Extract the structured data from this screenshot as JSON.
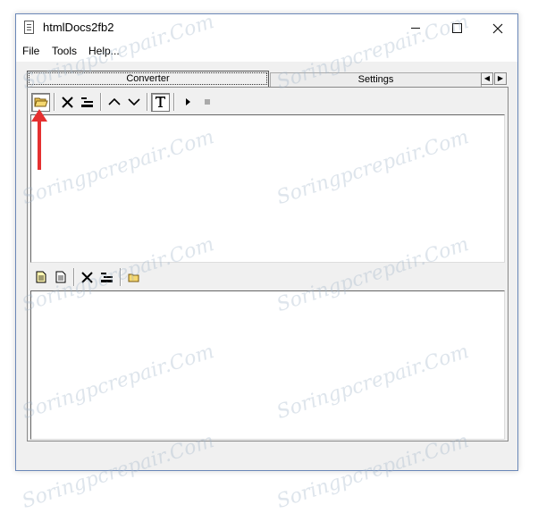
{
  "window": {
    "title": "htmlDocs2fb2",
    "controls": [
      "minimize",
      "maximize",
      "close"
    ]
  },
  "menu": {
    "items": [
      "File",
      "Tools",
      "Help..."
    ]
  },
  "tabs": {
    "items": [
      "Converter",
      "Settings"
    ],
    "active": "Converter"
  },
  "toolbar_top": {
    "icons": [
      "open-folder-icon",
      "delete-icon",
      "clear-list-icon",
      "move-up-icon",
      "move-down-icon",
      "text-mode-icon",
      "play-icon",
      "stop-icon"
    ]
  },
  "toolbar_bottom": {
    "icons": [
      "new-document-icon",
      "document-icon",
      "delete-icon",
      "clear-list-icon",
      "folder-icon"
    ]
  },
  "annotation": {
    "arrow_color": "#e53030"
  },
  "watermark": {
    "text": "Soringpcrepair.Com"
  },
  "colors": {
    "window_border": "#6b88b8",
    "chrome": "#f0f0f0",
    "arrow": "#e53030"
  }
}
